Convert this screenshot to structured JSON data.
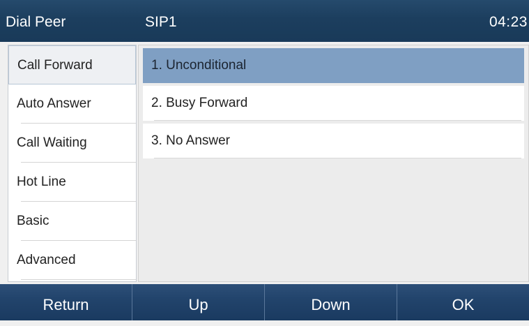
{
  "header": {
    "title": "Dial Peer",
    "account": "SIP1",
    "time": "04:23"
  },
  "sidebar": {
    "items": [
      {
        "label": "Call Forward",
        "active": true
      },
      {
        "label": "Auto Answer",
        "active": false
      },
      {
        "label": "Call Waiting",
        "active": false
      },
      {
        "label": "Hot Line",
        "active": false
      },
      {
        "label": "Basic",
        "active": false
      },
      {
        "label": "Advanced",
        "active": false
      }
    ]
  },
  "main": {
    "options": [
      {
        "label": "1.  Unconditional",
        "selected": true
      },
      {
        "label": "2.  Busy Forward",
        "selected": false
      },
      {
        "label": "3.  No Answer",
        "selected": false
      }
    ]
  },
  "softkeys": {
    "return": "Return",
    "up": "Up",
    "down": "Down",
    "ok": "OK"
  },
  "colors": {
    "header_bg": "#1c3e5e",
    "selected_bg": "#7f9fc3",
    "softkey_bg": "#22446c"
  }
}
